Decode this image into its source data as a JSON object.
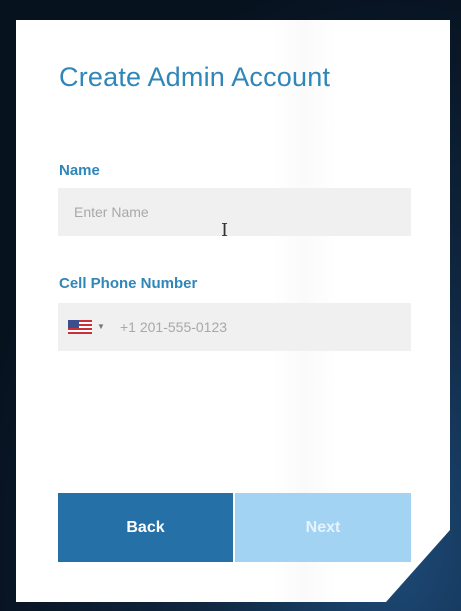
{
  "form": {
    "title": "Create Admin Account",
    "name_label": "Name",
    "name_placeholder": "Enter Name",
    "name_value": "",
    "phone_label": "Cell Phone Number",
    "phone_placeholder": "+1 201-555-0123",
    "phone_value": "",
    "country_flag_icon": "us-flag-icon",
    "country_caret": "▼"
  },
  "buttons": {
    "back_label": "Back",
    "next_label": "Next"
  },
  "colors": {
    "accent": "#2f86b9",
    "back_button": "#2571a7",
    "next_button_disabled": "#a2d3f3",
    "input_background": "#f0f0f0"
  }
}
